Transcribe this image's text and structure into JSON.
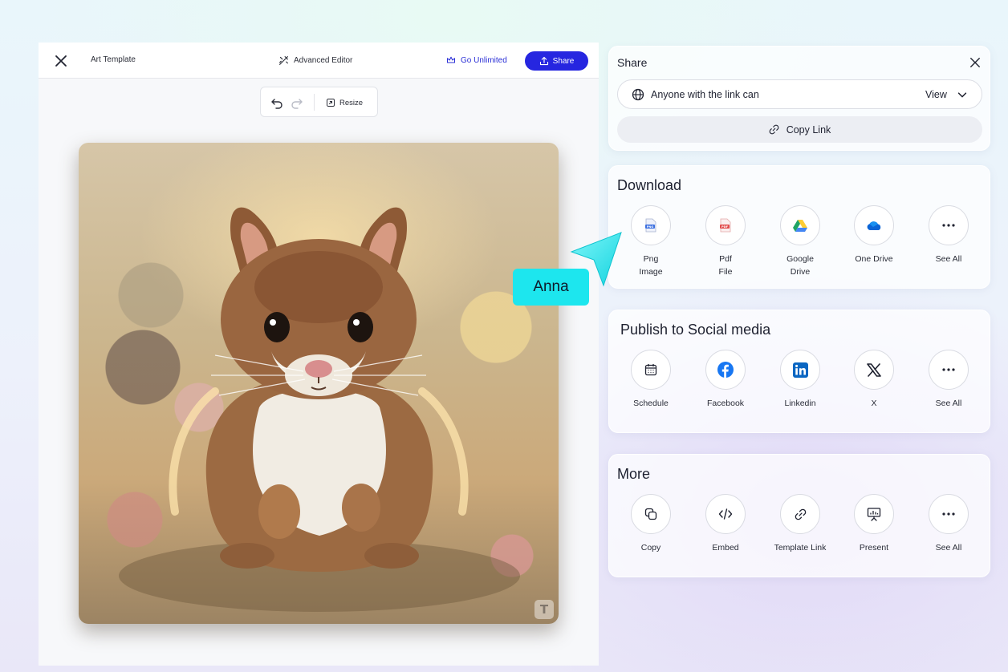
{
  "editor": {
    "title": "Art Template",
    "advanced_editor_label": "Advanced Editor",
    "go_unlimited_label": "Go Unlimited",
    "share_label": "Share",
    "toolbar": {
      "resize_label": "Resize"
    },
    "watermark_letter": "T",
    "accent_color": "#2626e0"
  },
  "share_panel": {
    "title": "Share",
    "access_text": "Anyone with the link can",
    "access_value": "View",
    "copy_link_label": "Copy Link"
  },
  "download": {
    "title": "Download",
    "options": [
      {
        "label": "Png\nImage",
        "icon": "png-file-icon"
      },
      {
        "label": "Pdf\nFile",
        "icon": "pdf-file-icon"
      },
      {
        "label": "Google\nDrive",
        "icon": "google-drive-icon"
      },
      {
        "label": "One Drive",
        "icon": "onedrive-icon"
      },
      {
        "label": "See All",
        "icon": "more-dots-icon"
      }
    ]
  },
  "social": {
    "title": "Publish to Social media",
    "options": [
      {
        "label": "Schedule",
        "icon": "calendar-icon"
      },
      {
        "label": "Facebook",
        "icon": "facebook-icon"
      },
      {
        "label": "Linkedin",
        "icon": "linkedin-icon"
      },
      {
        "label": "X",
        "icon": "x-logo-icon"
      },
      {
        "label": "See All",
        "icon": "more-dots-icon"
      }
    ]
  },
  "more": {
    "title": "More",
    "options": [
      {
        "label": "Copy",
        "icon": "copy-icon"
      },
      {
        "label": "Embed",
        "icon": "code-icon"
      },
      {
        "label": "Template Link",
        "icon": "link-icon"
      },
      {
        "label": "Present",
        "icon": "presentation-icon"
      },
      {
        "label": "See All",
        "icon": "more-dots-icon"
      }
    ]
  },
  "collaborator": {
    "name": "Anna",
    "color": "#1de6ee"
  }
}
